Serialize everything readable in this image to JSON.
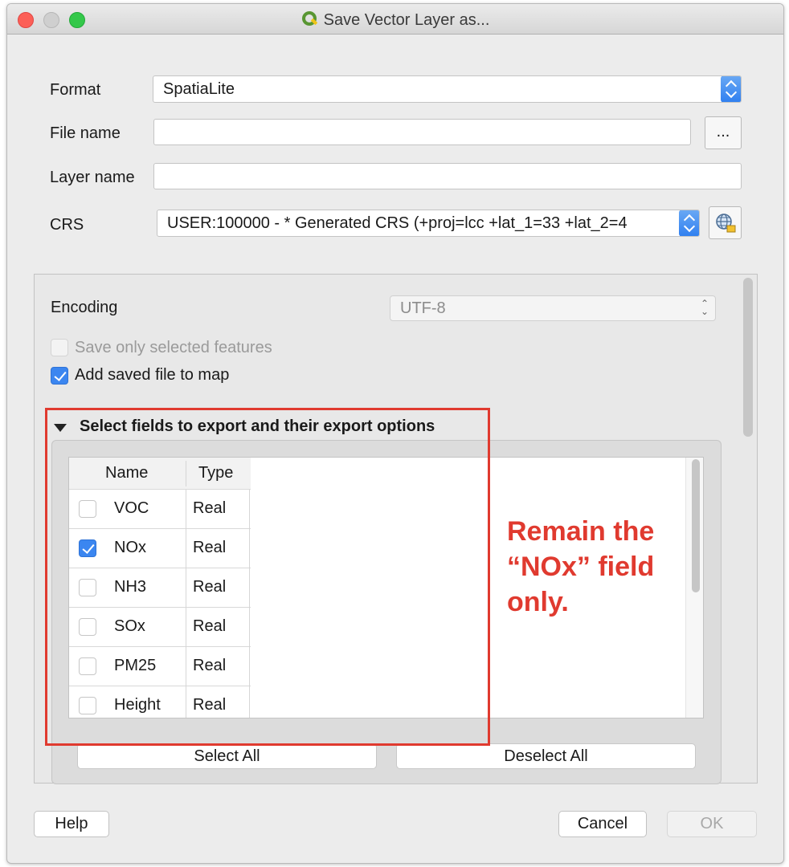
{
  "window": {
    "title": "Save Vector Layer as..."
  },
  "form": {
    "format_label": "Format",
    "format_value": "SpatiaLite",
    "filename_label": "File name",
    "filename_value": "",
    "browse_label": "...",
    "layername_label": "Layer name",
    "layername_value": "",
    "crs_label": "CRS",
    "crs_value": "USER:100000 -  * Generated CRS (+proj=lcc +lat_1=33 +lat_2=4"
  },
  "options": {
    "encoding_label": "Encoding",
    "encoding_value": "UTF-8",
    "save_selected_label": "Save only selected features",
    "save_selected_checked": false,
    "add_to_map_label": "Add saved file to map",
    "add_to_map_checked": true
  },
  "fields_group": {
    "title": "Select fields to export and their export options",
    "headers": [
      "Name",
      "Type"
    ],
    "rows": [
      {
        "name": "VOC",
        "type": "Real",
        "checked": false
      },
      {
        "name": "NOx",
        "type": "Real",
        "checked": true
      },
      {
        "name": "NH3",
        "type": "Real",
        "checked": false
      },
      {
        "name": "SOx",
        "type": "Real",
        "checked": false
      },
      {
        "name": "PM25",
        "type": "Real",
        "checked": false
      },
      {
        "name": "Height",
        "type": "Real",
        "checked": false
      }
    ],
    "select_all_label": "Select All",
    "deselect_all_label": "Deselect All"
  },
  "buttons": {
    "help": "Help",
    "cancel": "Cancel",
    "ok": "OK"
  },
  "annotation": {
    "lines": [
      "Remain the",
      "“NOx” field",
      "only."
    ],
    "color": "#e03a2f"
  }
}
